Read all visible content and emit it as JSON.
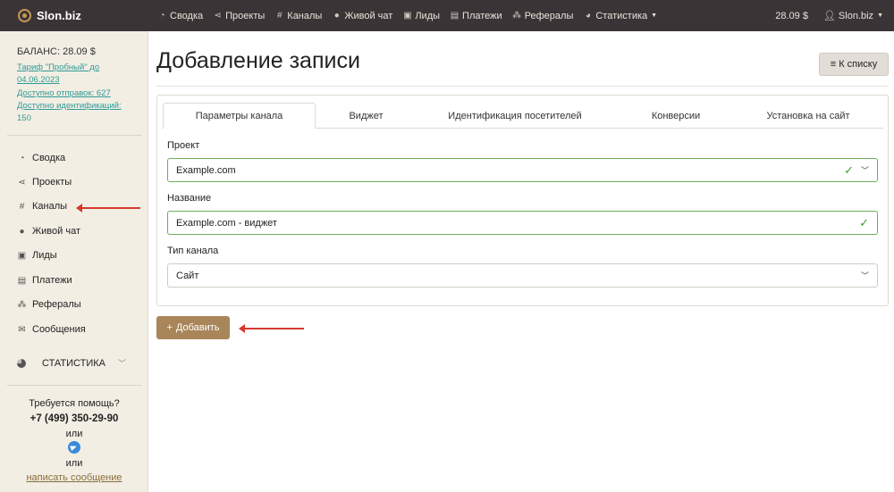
{
  "topbar": {
    "brand": "Slon.biz",
    "nav": [
      {
        "icon": "gauge-icon",
        "glyph": "◔",
        "label": "Сводка"
      },
      {
        "icon": "share-icon",
        "glyph": "⋖",
        "label": "Проекты"
      },
      {
        "icon": "hashtag-icon",
        "glyph": "#",
        "label": "Каналы"
      },
      {
        "icon": "chat-icon",
        "glyph": "●",
        "label": "Живой чат"
      },
      {
        "icon": "contact-card-icon",
        "glyph": "▣",
        "label": "Лиды"
      },
      {
        "icon": "money-icon",
        "glyph": "▤",
        "label": "Платежи"
      },
      {
        "icon": "sitemap-icon",
        "glyph": "⁂",
        "label": "Рефералы"
      },
      {
        "icon": "pie-chart-icon",
        "glyph": "◕",
        "label": "Статистика"
      }
    ],
    "balance": "28.09 $",
    "user": "Slon.biz"
  },
  "sidebar": {
    "balance": "БАЛАНС: 28.09 $",
    "tariff_line1": "Тариф \"Пробный\" до",
    "tariff_line2": "04.06.2023",
    "sends": "Доступно отправок: 627",
    "ident_line1": "Доступно идентификаций:",
    "ident_line2": "150",
    "items": [
      {
        "icon": "gauge-icon",
        "glyph": "◔",
        "label": "Сводка"
      },
      {
        "icon": "share-icon",
        "glyph": "⋖",
        "label": "Проекты"
      },
      {
        "icon": "hashtag-icon",
        "glyph": "#",
        "label": "Каналы"
      },
      {
        "icon": "chat-icon",
        "glyph": "●",
        "label": "Живой чат"
      },
      {
        "icon": "contact-card-icon",
        "glyph": "▣",
        "label": "Лиды"
      },
      {
        "icon": "money-icon",
        "glyph": "▤",
        "label": "Платежи"
      },
      {
        "icon": "sitemap-icon",
        "glyph": "⁂",
        "label": "Рефералы"
      },
      {
        "icon": "envelope-icon",
        "glyph": "✉",
        "label": "Сообщения"
      }
    ],
    "statistics": "СТАТИСТИКА",
    "help_title": "Требуется помощь?",
    "phone": "+7 (499) 350-29-90",
    "or1": "или",
    "or2": "или",
    "write_message": "написать сообщение"
  },
  "main": {
    "title": "Добавление записи",
    "list_button": "К списку",
    "tabs": [
      {
        "label": "Параметры канала",
        "active": true
      },
      {
        "label": "Виджет",
        "active": false
      },
      {
        "label": "Идентификация посетителей",
        "active": false
      },
      {
        "label": "Конверсии",
        "active": false
      },
      {
        "label": "Установка на сайт",
        "active": false
      }
    ],
    "fields": {
      "project_label": "Проект",
      "project_value": "Example.com",
      "name_label": "Название",
      "name_value": "Example.com - виджет",
      "type_label": "Тип канала",
      "type_value": "Сайт"
    },
    "add_button": "Добавить"
  },
  "colors": {
    "topbar_bg": "#3b3436",
    "sidebar_bg": "#f2eee4",
    "accent_button": "#a8865a",
    "link_teal": "#2f9b95",
    "valid_green": "#3e9a36",
    "annotation_arrow": "#d43a2f"
  }
}
